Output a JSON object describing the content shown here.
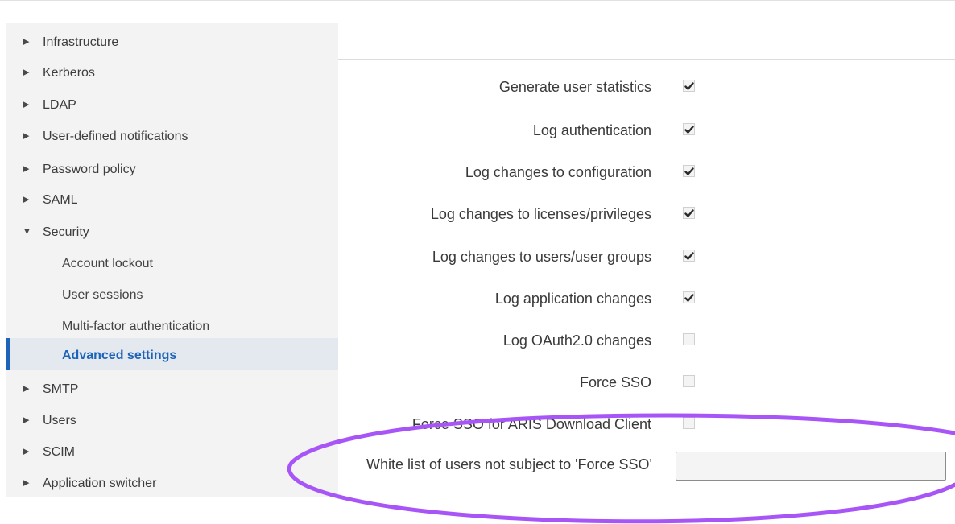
{
  "sidebar": {
    "items": [
      {
        "label": "Infrastructure",
        "arrow": "▶"
      },
      {
        "label": "Kerberos",
        "arrow": "▶"
      },
      {
        "label": "LDAP",
        "arrow": "▶"
      },
      {
        "label": "User-defined notifications",
        "arrow": "▶"
      },
      {
        "label": "Password policy",
        "arrow": "▶"
      },
      {
        "label": "SAML",
        "arrow": "▶"
      },
      {
        "label": "Security",
        "arrow": "▼",
        "expanded": true
      },
      {
        "label": "Account lockout"
      },
      {
        "label": "User sessions"
      },
      {
        "label": "Multi-factor authentication"
      },
      {
        "label": "Advanced settings",
        "active": true
      },
      {
        "label": "SMTP",
        "arrow": "▶"
      },
      {
        "label": "Users",
        "arrow": "▶"
      },
      {
        "label": "SCIM",
        "arrow": "▶"
      },
      {
        "label": "Application switcher",
        "arrow": "▶"
      }
    ],
    "active_color": "#1d63b7"
  },
  "settings": {
    "rows": [
      {
        "label": "Generate user statistics",
        "checked": true
      },
      {
        "label": "Log authentication",
        "checked": true
      },
      {
        "label": "Log changes to configuration",
        "checked": true
      },
      {
        "label": "Log changes to licenses/privileges",
        "checked": true
      },
      {
        "label": "Log changes to users/user groups",
        "checked": true
      },
      {
        "label": "Log application changes",
        "checked": true
      },
      {
        "label": "Log OAuth2.0 changes",
        "checked": false
      },
      {
        "label": "Force SSO",
        "checked": false
      },
      {
        "label": "Force SSO for ARIS Download Client",
        "checked": false
      }
    ],
    "whitelist": {
      "label": "White list of users not subject to 'Force SSO'",
      "value": ""
    }
  },
  "annotation": {
    "color": "#a855f7"
  }
}
